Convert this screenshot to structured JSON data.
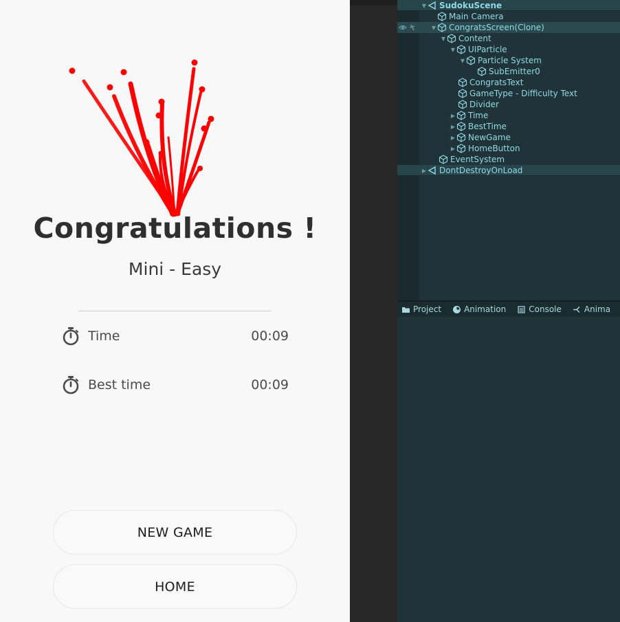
{
  "game_view": {
    "title": "Congratulations !",
    "game_type": "Mini - Easy",
    "stats": [
      {
        "icon": "stopwatch-icon",
        "label": "Time",
        "value": "00:09"
      },
      {
        "icon": "stopwatch-icon",
        "label": "Best time",
        "value": "00:09"
      }
    ],
    "buttons": {
      "new_game": "NEW GAME",
      "home": "HOME"
    },
    "colors": {
      "background": "#f8f8f8",
      "particle": "#ff0000",
      "text": "#2f2f2f"
    }
  },
  "hierarchy": {
    "scenes": [
      {
        "label": "SudokuScene",
        "expanded": true
      },
      {
        "label": "DontDestroyOnLoad",
        "expanded": false
      }
    ],
    "items": [
      {
        "label": "Main Camera"
      },
      {
        "label": "CongratsScreen(Clone)"
      },
      {
        "label": "Content"
      },
      {
        "label": "UIParticle"
      },
      {
        "label": "Particle System"
      },
      {
        "label": "SubEmitter0"
      },
      {
        "label": "CongratsText"
      },
      {
        "label": "GameType - Difficulty Text"
      },
      {
        "label": "Divider"
      },
      {
        "label": "Time"
      },
      {
        "label": "BestTime"
      },
      {
        "label": "NewGame"
      },
      {
        "label": "HomeButton"
      },
      {
        "label": "EventSystem"
      }
    ],
    "colors": {
      "background": "#203338",
      "text": "#8fd8e6",
      "scene_row": "#27454b"
    }
  },
  "bottom_tabs": [
    {
      "label": "Project",
      "icon": "folder-icon"
    },
    {
      "label": "Animation",
      "icon": "clock-icon"
    },
    {
      "label": "Console",
      "icon": "console-icon"
    },
    {
      "label": "Anima",
      "icon": "animator-icon"
    }
  ]
}
